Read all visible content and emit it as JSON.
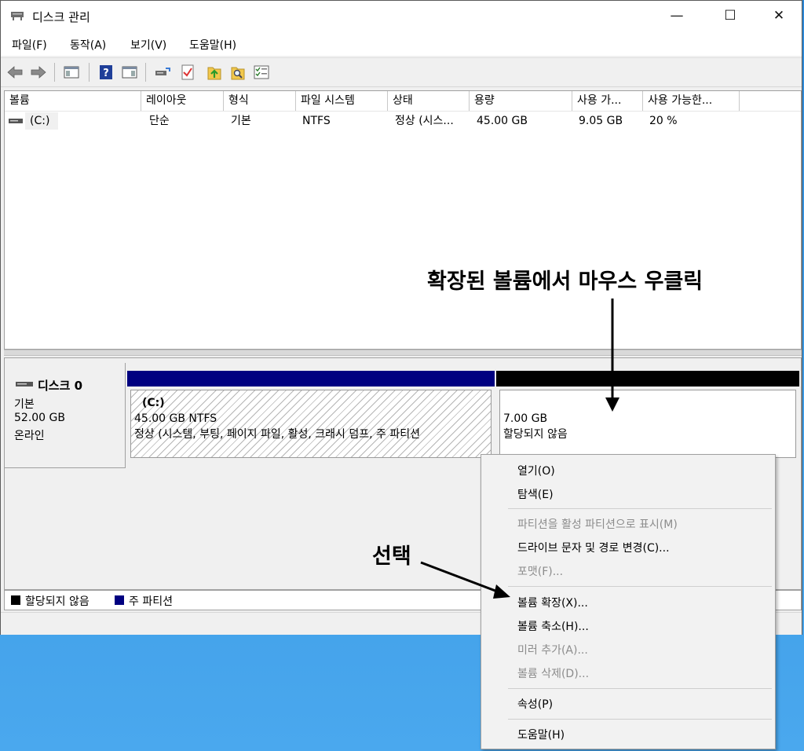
{
  "window": {
    "title": "디스크 관리",
    "buttons": {
      "minimize": "—",
      "maximize": "☐",
      "close": "✕"
    }
  },
  "menu": [
    "파일(F)",
    "동작(A)",
    "보기(V)",
    "도움말(H)"
  ],
  "toolbar_icons": [
    "back-icon",
    "forward-icon",
    "console-tree-icon",
    "help-icon",
    "action-pane-icon",
    "connect-icon",
    "check-icon",
    "upload-icon",
    "search-folder-icon",
    "properties-list-icon"
  ],
  "volume_list": {
    "columns": [
      "볼륨",
      "레이아웃",
      "형식",
      "파일 시스템",
      "상태",
      "용량",
      "사용 가...",
      "사용 가능한..."
    ],
    "rows": [
      {
        "volume": "(C:)",
        "layout": "단순",
        "type": "기본",
        "fs": "NTFS",
        "status": "정상 (시스...",
        "capacity": "45.00 GB",
        "free": "9.05 GB",
        "free_pct": "20 %"
      }
    ]
  },
  "disk": {
    "name": "디스크 0",
    "type": "기본",
    "size": "52.00 GB",
    "status": "온라인",
    "partitions": [
      {
        "label": "(C:)",
        "size_fs": "45.00 GB NTFS",
        "status": "정상 (시스템, 부팅, 페이지 파일, 활성, 크래시 덤프, 주 파티션",
        "bar_color": "#000080"
      },
      {
        "label": "",
        "size_fs": "7.00 GB",
        "status": "할당되지 않음",
        "bar_color": "#000000"
      }
    ]
  },
  "legend": [
    {
      "label": "할당되지 않음",
      "color": "#000000"
    },
    {
      "label": "주 파티션",
      "color": "#000080"
    }
  ],
  "context_menu": [
    {
      "label": "열기(O)",
      "enabled": true
    },
    {
      "label": "탐색(E)",
      "enabled": true
    },
    {
      "label": "파티션을 활성 파티션으로 표시(M)",
      "enabled": false
    },
    {
      "label": "드라이브 문자 및 경로 변경(C)...",
      "enabled": true
    },
    {
      "label": "포맷(F)...",
      "enabled": false
    },
    {
      "label": "볼륨 확장(X)...",
      "enabled": true
    },
    {
      "label": "볼륨 축소(H)...",
      "enabled": true
    },
    {
      "label": "미러 추가(A)...",
      "enabled": false
    },
    {
      "label": "볼륨 삭제(D)...",
      "enabled": false
    },
    {
      "label": "속성(P)",
      "enabled": true
    },
    {
      "label": "도움말(H)",
      "enabled": true
    }
  ],
  "annotations": {
    "right_click": "확장된 볼륨에서 마우스 우클릭",
    "select": "선택"
  }
}
